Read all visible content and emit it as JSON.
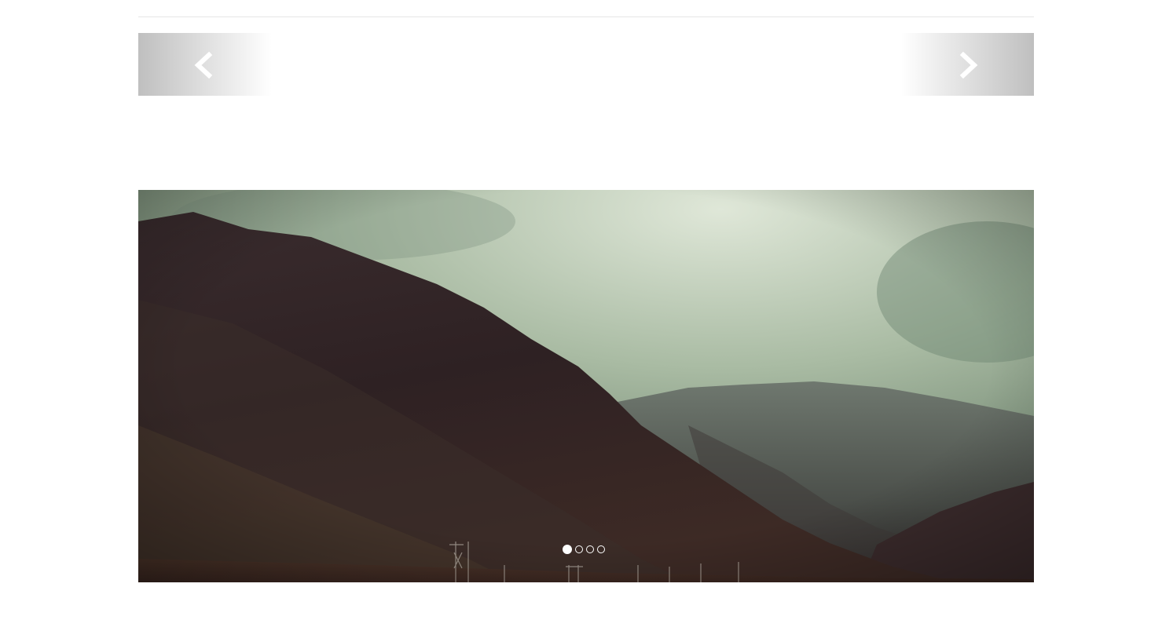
{
  "slider": {
    "prev_icon": "chevron-left-icon",
    "next_icon": "chevron-right-icon",
    "image": "mountain-landscape",
    "slide_count": 4,
    "active_slide": 1
  },
  "colors": {
    "arrow": "#ffffff",
    "sky": "#a9bba3",
    "mountain_dark": "#2a1e20",
    "mountain_far": "#5a5e58",
    "divider": "#e6e6e6"
  }
}
